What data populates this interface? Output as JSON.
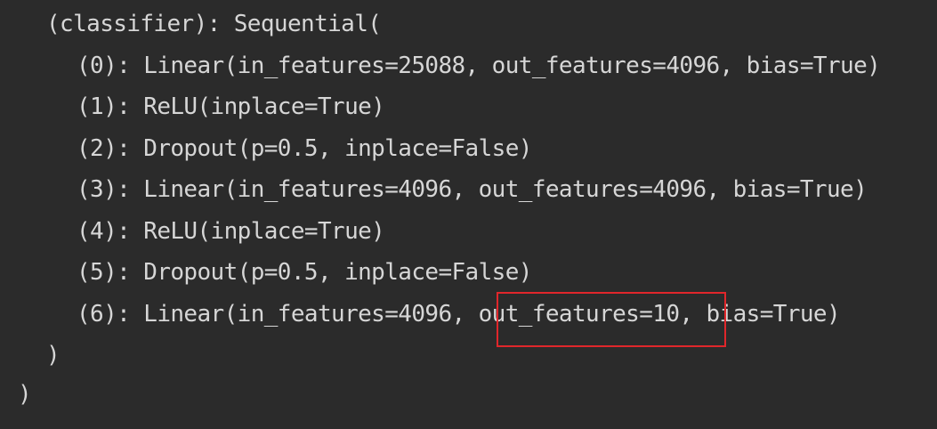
{
  "console": {
    "lines": [
      "(classifier): Sequential(",
      "(0): Linear(in_features=25088, out_features=4096, bias=True)",
      "(1): ReLU(inplace=True)",
      "(2): Dropout(p=0.5, inplace=False)",
      "(3): Linear(in_features=4096, out_features=4096, bias=True)",
      "(4): ReLU(inplace=True)",
      "(5): Dropout(p=0.5, inplace=False)",
      "(6): Linear(in_features=4096, out_features=10, bias=True)",
      ")",
      ")"
    ],
    "highlighted_text": "out_features=10",
    "highlight_color": "#e0262b",
    "background_color": "#2b2b2b",
    "text_color": "#d6d6d6"
  }
}
